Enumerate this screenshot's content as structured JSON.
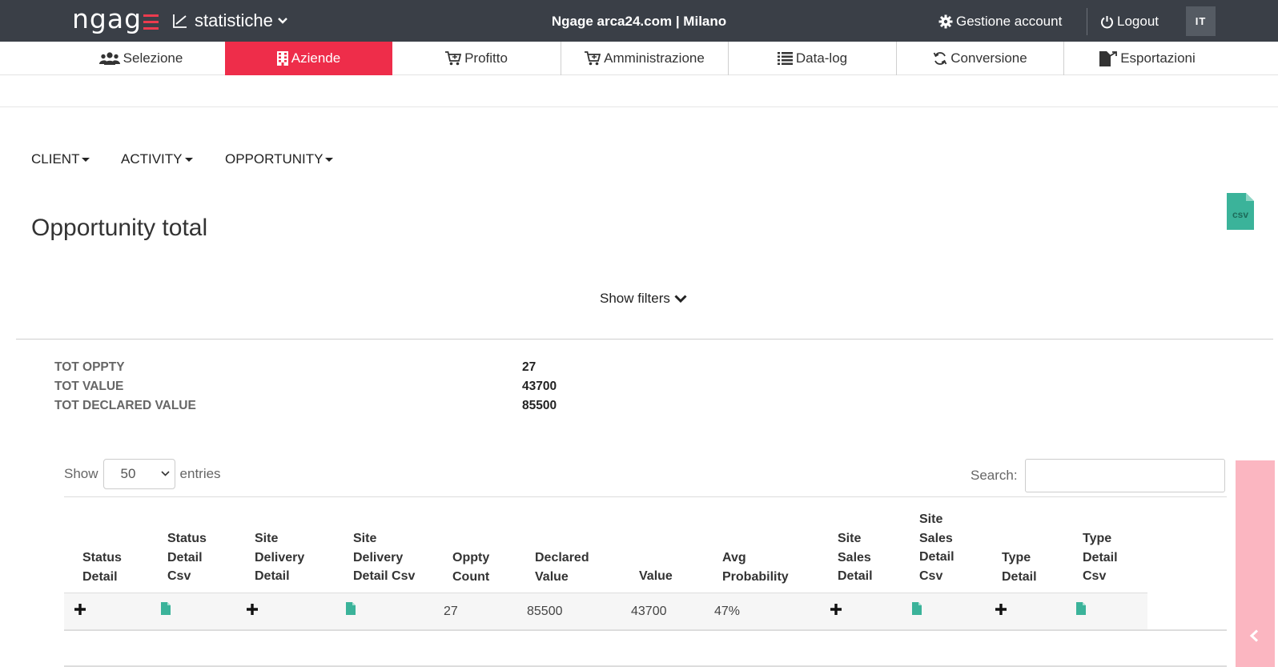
{
  "header": {
    "logo_text": "ngag",
    "app_name": "statistiche",
    "title": "Ngage arca24.com | Milano",
    "account_label": "Gestione account",
    "logout_label": "Logout",
    "language": "IT",
    "accent_color": "#ee2d4a"
  },
  "nav": {
    "items": [
      {
        "label": "Selezione",
        "icon": "users-icon"
      },
      {
        "label": "Aziende",
        "icon": "building-icon",
        "active": true
      },
      {
        "label": "Profitto",
        "icon": "cart-icon"
      },
      {
        "label": "Amministrazione",
        "icon": "cart-icon"
      },
      {
        "label": "Data-log",
        "icon": "list-icon"
      },
      {
        "label": "Conversione",
        "icon": "refresh-icon"
      },
      {
        "label": "Esportazioni",
        "icon": "file-export-icon"
      }
    ]
  },
  "submenu": {
    "client": "CLIENT",
    "activity": "ACTIVITY",
    "opportunity": "OPPORTUNITY"
  },
  "page": {
    "title": "Opportunity total",
    "csv_label": "csv",
    "show_filters": "Show filters"
  },
  "totals": [
    {
      "label": "TOT OPPTY",
      "value": "27"
    },
    {
      "label": "TOT VALUE",
      "value": "43700"
    },
    {
      "label": "TOT DECLARED VALUE",
      "value": "85500"
    }
  ],
  "table_controls": {
    "show_label": "Show",
    "entries_value": "50",
    "entries_label": "entries",
    "search_label": "Search:"
  },
  "table": {
    "headers": [
      [
        "Status",
        "Detail"
      ],
      [
        "Status",
        "Detail",
        "Csv"
      ],
      [
        "Site",
        "Delivery",
        "Detail"
      ],
      [
        "Site",
        "Delivery",
        "Detail Csv"
      ],
      [
        "Oppty",
        "Count"
      ],
      [
        "Declared",
        "Value"
      ],
      [
        "Value"
      ],
      [
        "Avg",
        "Probability"
      ],
      [
        "Site",
        "Sales",
        "Detail"
      ],
      [
        "Site",
        "Sales",
        "Detail",
        "Csv"
      ],
      [
        "Type",
        "Detail"
      ],
      [
        "Type",
        "Detail",
        "Csv"
      ]
    ],
    "row": {
      "oppty_count": "27",
      "declared_value": "85500",
      "value": "43700",
      "avg_probability": "47%"
    }
  }
}
